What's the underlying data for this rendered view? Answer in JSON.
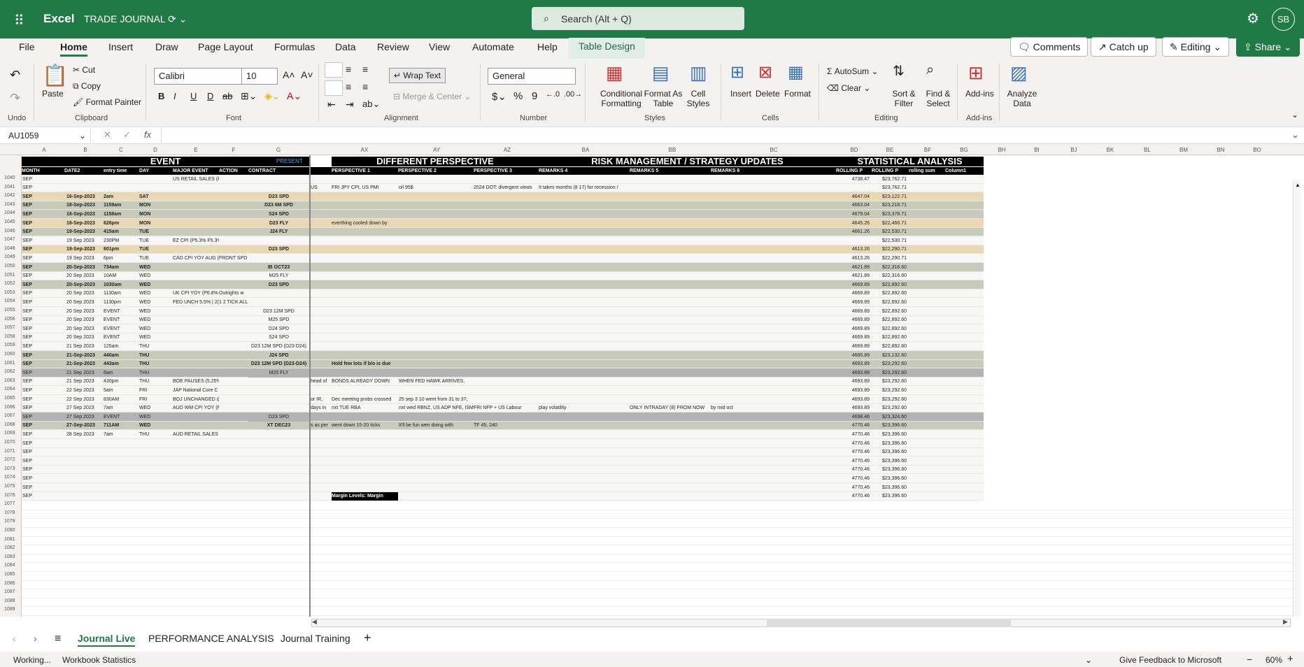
{
  "app": {
    "waffle": "⠿",
    "name": "Excel",
    "doc_title": "TRADE JOURNAL",
    "doc_suffix": "⟳ ⌄",
    "search_placeholder": "Search (Alt + Q)",
    "avatar": "SB"
  },
  "menu": [
    "File",
    "Home",
    "Insert",
    "Draw",
    "Page Layout",
    "Formulas",
    "Data",
    "Review",
    "View",
    "Automate",
    "Help",
    "Table Design"
  ],
  "top_buttons": {
    "comments": "Comments",
    "catchup": "Catch up",
    "editing": "Editing",
    "share": "Share"
  },
  "ribbon": {
    "undo_label": "Undo",
    "paste": "Paste",
    "cut": "Cut",
    "copy": "Copy",
    "format_painter": "Format Painter",
    "clipboard": "Clipboard",
    "font_name": "Calibri",
    "font_size": "10",
    "font_group": "Font",
    "wrap_text": "Wrap Text",
    "merge_center": "Merge & Center",
    "alignment": "Alignment",
    "number_format": "General",
    "number_group": "Number",
    "cond_fmt": "Conditional Formatting",
    "format_table": "Format As Table",
    "cell_styles": "Cell Styles",
    "styles_group": "Styles",
    "insert": "Insert",
    "delete": "Delete",
    "format": "Format",
    "cells_group": "Cells",
    "autosum": "AutoSum",
    "clear": "Clear",
    "sort_filter": "Sort & Filter",
    "find_select": "Find & Select",
    "editing_group": "Editing",
    "addins": "Add-ins",
    "addins_group": "Add-ins",
    "analyze": "Analyze Data"
  },
  "formula": {
    "name_box": "AU1059",
    "fx": "fx",
    "content": ""
  },
  "columns": [
    "A",
    "B",
    "C",
    "D",
    "E",
    "F",
    "G",
    "AX",
    "AY",
    "AZ",
    "BA",
    "BB",
    "BC",
    "BD",
    "BE",
    "BF",
    "BG",
    "BH",
    "BI",
    "BJ",
    "BK",
    "BL",
    "BM",
    "BN",
    "BO"
  ],
  "headers": {
    "event": "EVENT",
    "present": "PRESENT",
    "perspective": "DIFFERENT PERSPECTIVE",
    "risk": "RISK MANAGEMENT / STRATEGY UPDATES",
    "stats": "STATISTICAL ANALYSIS",
    "cols": [
      "MONTH",
      "DATE2",
      "entry time",
      "DAY",
      "MAJOR EVENT",
      "ACTION",
      "CONTRACT",
      "PERSPECTIVE 1",
      "PERSPECTIVE 2",
      "PERSPECTIVE 3",
      "REMARKS 4",
      "REMARKS 5",
      "REMARKS 6",
      "ROLLING P",
      "ROLLING P",
      "rolling sum",
      "Column1"
    ]
  },
  "rows": [
    {
      "n": "1040",
      "a": "SEP",
      "b": "",
      "c": "",
      "d": "",
      "e": "US RETAIL SALES (P",
      "g": "",
      "x": "",
      "p1": "",
      "p2": "",
      "p3": "",
      "r4": "",
      "r5": "",
      "r6": "",
      "bd": "4738.47",
      "be": "$23,762.71",
      "bg": ""
    },
    {
      "n": "1041",
      "a": "SEP",
      "b": "",
      "c": "",
      "d": "",
      "e": "",
      "g": "",
      "x": "US",
      "p1": "FRI JPY CPI, US PMI",
      "p2": "oil 95$",
      "p3": "2024 DOT: divergent views",
      "r4": "It takes months (8 17) for recession /",
      "r5": "",
      "r6": "",
      "bd": "",
      "be": "$23,762.71",
      "bg": ""
    },
    {
      "n": "1042",
      "a": "SEP",
      "b": "16-Sep-2023",
      "c": "2am",
      "d": "SAT",
      "e": "",
      "g": "D23 SPD",
      "x": "",
      "p1": "",
      "p2": "",
      "p3": "",
      "r4": "",
      "r5": "",
      "r6": "",
      "bd": "4647.04",
      "be": "$23,122.71",
      "bg": "tan"
    },
    {
      "n": "1043",
      "a": "SEP",
      "b": "18-Sep-2023",
      "c": "1159am",
      "d": "MON",
      "e": "",
      "g": "D23 6M SPD",
      "x": "",
      "p1": "",
      "p2": "",
      "p3": "",
      "r4": "",
      "r5": "",
      "r6": "",
      "bd": "4663.04",
      "be": "$23,218.71",
      "bg": "sage"
    },
    {
      "n": "1044",
      "a": "SEP",
      "b": "18-Sep-2023",
      "c": "1158am",
      "d": "MON",
      "e": "",
      "g": "S24 SPD",
      "x": "",
      "p1": "",
      "p2": "",
      "p3": "",
      "r4": "",
      "r5": "",
      "r6": "",
      "bd": "4679.04",
      "be": "$23,378.71",
      "bg": "sage"
    },
    {
      "n": "1045",
      "a": "SEP",
      "b": "18-Sep-2023",
      "c": "626pm",
      "d": "MON",
      "e": "",
      "g": "D23 FLY",
      "x": "",
      "p1": "everthing cooled down by",
      "p2": "",
      "p3": "",
      "r4": "",
      "r5": "",
      "r6": "",
      "bd": "4645.26",
      "be": "$22,466.71",
      "bg": "tan"
    },
    {
      "n": "1046",
      "a": "SEP",
      "b": "19-Sep-2023",
      "c": "415am",
      "d": "TUE",
      "e": "",
      "g": "J24 FLY",
      "x": "",
      "p1": "",
      "p2": "",
      "p3": "",
      "r4": "",
      "r5": "",
      "r6": "",
      "bd": "4661.26",
      "be": "$22,530.71",
      "bg": "sage"
    },
    {
      "n": "1047",
      "a": "SEP",
      "b": "19 Sep 2023",
      "c": "230PM",
      "d": "TUE",
      "e": "EZ CPI (P5.3% F5.3%",
      "g": "",
      "x": "",
      "p1": "",
      "p2": "",
      "p3": "",
      "r4": "",
      "r5": "",
      "r6": "",
      "bd": "",
      "be": "$22,530.71",
      "bg": ""
    },
    {
      "n": "1048",
      "a": "SEP",
      "b": "19-Sep-2023",
      "c": "601pm",
      "d": "TUE",
      "e": "",
      "g": "D23 SPD",
      "x": "",
      "p1": "",
      "p2": "",
      "p3": "",
      "r4": "",
      "r5": "",
      "r6": "",
      "bd": "4613.26",
      "be": "$22,290.71",
      "bg": "tan"
    },
    {
      "n": "1049",
      "a": "SEP",
      "b": "19 Sep 2023",
      "c": "6pm",
      "d": "TUE",
      "e": "CAD CPI YOY AUG (F",
      "f": "FRONT SPD",
      "g": "",
      "x": "",
      "p1": "",
      "p2": "",
      "p3": "",
      "r4": "",
      "r5": "",
      "r6": "",
      "bd": "4613.26",
      "be": "$22,290.71",
      "bg": ""
    },
    {
      "n": "1050",
      "a": "SEP",
      "b": "20-Sep-2023",
      "c": "734am",
      "d": "WED",
      "e": "",
      "g": "IB OCT23",
      "x": "",
      "p1": "",
      "p2": "",
      "p3": "",
      "r4": "",
      "r5": "",
      "r6": "",
      "bd": "4621.89",
      "be": "$22,316.60",
      "bg": "sage"
    },
    {
      "n": "1051",
      "a": "SEP",
      "b": "20 Sep 2023",
      "c": "10AM",
      "d": "WED",
      "e": "",
      "g": "M25 FLY",
      "x": "",
      "p1": "",
      "p2": "",
      "p3": "",
      "r4": "",
      "r5": "",
      "r6": "",
      "bd": "4621.89",
      "be": "$22,316.60",
      "bg": ""
    },
    {
      "n": "1052",
      "a": "SEP",
      "b": "20-Sep-2023",
      "c": "1030am",
      "d": "WED",
      "e": "",
      "g": "D23 SPD",
      "x": "",
      "p1": "",
      "p2": "",
      "p3": "",
      "r4": "",
      "r5": "",
      "r6": "",
      "bd": "4669.89",
      "be": "$22,892.60",
      "bg": "sage"
    },
    {
      "n": "1053",
      "a": "SEP",
      "b": "20 Sep 2023",
      "c": "1130am",
      "d": "WED",
      "e": "UK CPI YOY (P6.8% F",
      "f": "Outrights w",
      "g": "",
      "x": "",
      "p1": "",
      "p2": "",
      "p3": "",
      "r4": "",
      "r5": "",
      "r6": "",
      "bd": "4669.89",
      "be": "$22,892.60",
      "bg": ""
    },
    {
      "n": "1054",
      "a": "SEP",
      "b": "20 Sep 2023",
      "c": "1130pm",
      "d": "WED",
      "e": "FED UNCH 5.5% | 2(",
      "f": "1 2 TICK ALL",
      "g": "",
      "x": "",
      "p1": "",
      "p2": "",
      "p3": "",
      "r4": "",
      "r5": "",
      "r6": "",
      "bd": "4669.89",
      "be": "$22,892.60",
      "bg": ""
    },
    {
      "n": "1055",
      "a": "SEP",
      "b": "20 Sep 2023",
      "c": "EVENT",
      "d": "WED",
      "e": "",
      "g": "D23 12M SPD",
      "x": "",
      "p1": "",
      "p2": "",
      "p3": "",
      "r4": "",
      "r5": "",
      "r6": "",
      "bd": "4669.89",
      "be": "$22,892.60",
      "bg": ""
    },
    {
      "n": "1056",
      "a": "SEP",
      "b": "20 Sep 2023",
      "c": "EVENT",
      "d": "WED",
      "e": "",
      "g": "M25 SPD",
      "x": "",
      "p1": "",
      "p2": "",
      "p3": "",
      "r4": "",
      "r5": "",
      "r6": "",
      "bd": "4669.89",
      "be": "$22,892.60",
      "bg": ""
    },
    {
      "n": "1057",
      "a": "SEP",
      "b": "20 Sep 2023",
      "c": "EVENT",
      "d": "WED",
      "e": "",
      "g": "D24 SPD",
      "x": "",
      "p1": "",
      "p2": "",
      "p3": "",
      "r4": "",
      "r5": "",
      "r6": "",
      "bd": "4669.89",
      "be": "$22,892.60",
      "bg": ""
    },
    {
      "n": "1058",
      "a": "SEP",
      "b": "20 Sep 2023",
      "c": "EVENT",
      "d": "WED",
      "e": "",
      "g": "S24 SPD",
      "x": "",
      "p1": "",
      "p2": "",
      "p3": "",
      "r4": "",
      "r5": "",
      "r6": "",
      "bd": "4669.89",
      "be": "$22,892.60",
      "bg": ""
    },
    {
      "n": "1059",
      "a": "SEP",
      "b": "21 Sep 2023",
      "c": "125am",
      "d": "THU",
      "e": "",
      "g": "D23 12M SPD (D23 D24)",
      "x": "",
      "p1": "",
      "p2": "",
      "p3": "",
      "r4": "",
      "r5": "",
      "r6": "",
      "bd": "4669.89",
      "be": "$22,892.60",
      "bg": ""
    },
    {
      "n": "1060",
      "a": "SEP",
      "b": "21-Sep-2023",
      "c": "440am",
      "d": "THU",
      "e": "",
      "g": "J24 SPD",
      "x": "",
      "p1": "",
      "p2": "",
      "p3": "",
      "r4": "",
      "r5": "",
      "r6": "",
      "bd": "4685.89",
      "be": "$23,132.60",
      "bg": "sage"
    },
    {
      "n": "1061",
      "a": "SEP",
      "b": "21-Sep-2023",
      "c": "443am",
      "d": "THU",
      "e": "",
      "g": "D23 12M SPD (D23-D24)",
      "x": "",
      "p1": "Hold few lots if b/o is due",
      "p2": "",
      "p3": "",
      "r4": "",
      "r5": "",
      "r6": "",
      "bd": "4693.89",
      "be": "$23,292.60",
      "bg": "sage"
    },
    {
      "n": "1062",
      "a": "SEP",
      "b": "21 Sep 2023",
      "c": "6am",
      "d": "THU",
      "e": "",
      "g": "M25 FLY",
      "x": "",
      "p1": "",
      "p2": "",
      "p3": "",
      "r4": "",
      "r5": "",
      "r6": "",
      "bd": "4693.89",
      "be": "$23,292.60",
      "bg": "gray"
    },
    {
      "n": "1063",
      "a": "SEP",
      "b": "21 Sep 2023",
      "c": "430pm",
      "d": "THU",
      "e": "BOE PAUSES (5.25%",
      "g": "",
      "x": "head of",
      "p1": "BONDS ALREADY DOWN",
      "p2": "WHEN FED HAWK ARRIVES,",
      "p3": "",
      "r4": "",
      "r5": "",
      "r6": "",
      "bd": "4693.89",
      "be": "$23,292.60",
      "bg": ""
    },
    {
      "n": "1064",
      "a": "SEP",
      "b": "22 Sep 2023",
      "c": "5am",
      "d": "FRI",
      "e": "JAP National Core C",
      "g": "",
      "x": "",
      "p1": "",
      "p2": "",
      "p3": "",
      "r4": "",
      "r5": "",
      "r6": "",
      "bd": "4693.89",
      "be": "$23,292.60",
      "bg": ""
    },
    {
      "n": "1065",
      "a": "SEP",
      "b": "22 Sep 2023",
      "c": "830AM",
      "d": "FRI",
      "e": "BOJ UNCHANGED @",
      "g": "",
      "x": "or IR,",
      "p1": "Dec meeting probs crossed",
      "p2": "25 sep 3 10 went from 31 to 37;",
      "p3": "",
      "r4": "",
      "r5": "",
      "r6": "",
      "bd": "4693.89",
      "be": "$23,292.60",
      "bg": ""
    },
    {
      "n": "1066",
      "a": "SEP",
      "b": "27 Sep 2023",
      "c": "7am",
      "d": "WED",
      "e": "AUD WM CPI YOY (F",
      "g": "",
      "x": "days in",
      "p1": "nxt TUE RBA",
      "p2": "nxt wed RBNZ, US ADP NFE, ISM",
      "p3": "FRI NFP + US Labour",
      "r4": "play volatility",
      "r5": "ONLY INTRADAY (8) FROM NOW",
      "r6": "by mid oct",
      "bd": "4693.89",
      "be": "$23,292.60",
      "bg": ""
    },
    {
      "n": "1067",
      "a": "SEP",
      "b": "27 Sep 2023",
      "c": "EVENT",
      "d": "WED",
      "e": "",
      "g": "D23 SPD",
      "x": "",
      "p1": "",
      "p2": "",
      "p3": "",
      "r4": "",
      "r5": "",
      "r6": "",
      "bd": "4698.46",
      "be": "$23,324.60",
      "bg": "gray"
    },
    {
      "n": "1068",
      "a": "SEP",
      "b": "27-Sep-2023",
      "c": "711AM",
      "d": "WED",
      "e": "",
      "g": "XT DEC23",
      "x": "s as per",
      "p1": "went down 15-20 ticks",
      "p2": "It'll be fun wen doing with",
      "p3": "TF 45, 240",
      "r4": "",
      "r5": "",
      "r6": "",
      "bd": "4770.46",
      "be": "$23,396.60",
      "bg": "sage"
    },
    {
      "n": "1069",
      "a": "SEP",
      "b": "28 Sep 2023",
      "c": "7am",
      "d": "THU",
      "e": "AUD RETAIL SALES (I",
      "g": "",
      "x": "",
      "p1": "",
      "p2": "",
      "p3": "",
      "r4": "",
      "r5": "",
      "r6": "",
      "bd": "4770.46",
      "be": "$23,396.60",
      "bg": ""
    },
    {
      "n": "1070",
      "a": "SEP",
      "b": "",
      "c": "",
      "d": "",
      "e": "",
      "g": "",
      "x": "",
      "p1": "",
      "p2": "",
      "p3": "",
      "r4": "",
      "r5": "",
      "r6": "",
      "bd": "4770.46",
      "be": "$23,396.60",
      "bg": ""
    },
    {
      "n": "1071",
      "a": "SEP",
      "b": "",
      "c": "",
      "d": "",
      "e": "",
      "g": "",
      "x": "",
      "p1": "",
      "p2": "",
      "p3": "",
      "r4": "",
      "r5": "",
      "r6": "",
      "bd": "4770.46",
      "be": "$23,396.60",
      "bg": ""
    },
    {
      "n": "1072",
      "a": "SEP",
      "b": "",
      "c": "",
      "d": "",
      "e": "",
      "g": "",
      "x": "",
      "p1": "",
      "p2": "",
      "p3": "",
      "r4": "",
      "r5": "",
      "r6": "",
      "bd": "4770.46",
      "be": "$23,396.60",
      "bg": ""
    },
    {
      "n": "1073",
      "a": "SEP",
      "b": "",
      "c": "",
      "d": "",
      "e": "",
      "g": "",
      "x": "",
      "p1": "",
      "p2": "",
      "p3": "",
      "r4": "",
      "r5": "",
      "r6": "",
      "bd": "4770.46",
      "be": "$23,396.60",
      "bg": ""
    },
    {
      "n": "1074",
      "a": "SEP",
      "b": "",
      "c": "",
      "d": "",
      "e": "",
      "g": "",
      "x": "",
      "p1": "",
      "p2": "",
      "p3": "",
      "r4": "",
      "r5": "",
      "r6": "",
      "bd": "4770.46",
      "be": "$23,396.60",
      "bg": ""
    },
    {
      "n": "1075",
      "a": "SEP",
      "b": "",
      "c": "",
      "d": "",
      "e": "",
      "g": "",
      "x": "",
      "p1": "",
      "p2": "",
      "p3": "",
      "r4": "",
      "r5": "",
      "r6": "",
      "bd": "4770.46",
      "be": "$23,396.60",
      "bg": ""
    },
    {
      "n": "1076",
      "a": "SEP",
      "b": "",
      "c": "",
      "d": "",
      "e": "",
      "g": "",
      "x": "",
      "p1": "Margin Levels: Margin",
      "p2": "",
      "p3": "",
      "r4": "",
      "r5": "",
      "r6": "",
      "bd": "4770.46",
      "be": "$23,396.60",
      "bg": ""
    }
  ],
  "empty_rows": [
    "1077",
    "1078",
    "1079",
    "1080",
    "1081",
    "1082",
    "1083",
    "1084",
    "1085",
    "1086",
    "1087",
    "1088",
    "1089"
  ],
  "sheets": [
    "Journal Live",
    "PERFORMANCE ANALYSIS",
    "Journal Training"
  ],
  "status": {
    "working": "Working...",
    "workbook_stats": "Workbook Statistics",
    "feedback": "Give Feedback to Microsoft",
    "zoom": "60%"
  },
  "colors": {
    "accent": "#1f7a45",
    "tan": "#e8d8b4",
    "sage": "#c8cbb9",
    "gray": "#b3b3b3"
  }
}
